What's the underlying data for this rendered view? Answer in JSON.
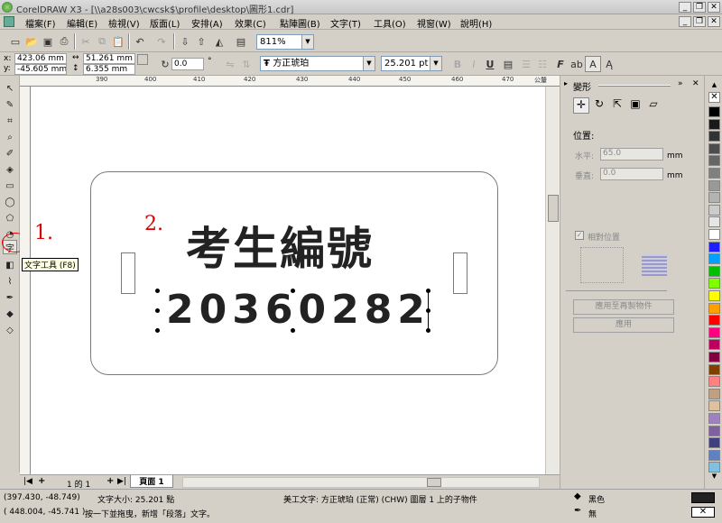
{
  "window": {
    "title": "CorelDRAW X3 - [\\\\a28s003\\cwcsk$\\profile\\desktop\\圖形1.cdr]"
  },
  "menu": [
    "檔案(F)",
    "編輯(E)",
    "檢視(V)",
    "版面(L)",
    "安排(A)",
    "效果(C)",
    "點陣圖(B)",
    "文字(T)",
    "工具(O)",
    "視窗(W)",
    "說明(H)"
  ],
  "standard_toolbar": {
    "zoom": "811%"
  },
  "property_bar": {
    "x": "423.06 mm",
    "y": "-45.605 mm",
    "width": "51.261 mm",
    "height": "6.355 mm",
    "rotation": "0.0",
    "degree_sign": "°",
    "font_name": "方正琥珀",
    "font_size": "25.201 pt"
  },
  "ruler": {
    "h_ticks": [
      "390",
      "400",
      "410",
      "420",
      "430",
      "440",
      "450",
      "460",
      "470"
    ],
    "unit": "公釐"
  },
  "tooltip": "文字工具 (F8)",
  "annotations": {
    "step1": "1.",
    "step2": "2."
  },
  "canvas": {
    "heading": "考生編號",
    "number": "20360282"
  },
  "page_tabs": {
    "page_count": "1 的 1",
    "tab": "頁面 1"
  },
  "docker": {
    "title": "變形",
    "section": "位置:",
    "h_label": "水平:",
    "h_value": "65.0",
    "v_label": "垂直:",
    "v_value": "0.0",
    "unit": "mm",
    "relative": "相對位置",
    "apply_copy": "應用至再製物件",
    "apply": "應用"
  },
  "status": {
    "coords1": "(397.430, -48.749)",
    "font_size": "文字大小: 25.201 點",
    "object_info": "美工文字: 方正琥珀 (正常) (CHW) 圖層 1 上的子物件",
    "coords2": "( 448.004, -45.741 )",
    "hint": "按一下並拖曳，新增「段落」文字。",
    "fill": "黑色",
    "outline": "無"
  },
  "palette": [
    "#000000",
    "#1a1a1a",
    "#333333",
    "#4d4d4d",
    "#666666",
    "#808080",
    "#999999",
    "#b3b3b3",
    "#cccccc",
    "#e6e6e6",
    "#ffffff",
    "#2020ff",
    "#00a0ff",
    "#00c000",
    "#80ff00",
    "#ffff00",
    "#ffa000",
    "#ff0000",
    "#ff0080",
    "#c00060",
    "#800040",
    "#804000",
    "#ff8080",
    "#c0a080",
    "#e0c0a0",
    "#a080c0",
    "#8060a0",
    "#404080",
    "#6080c0",
    "#80c0e0"
  ]
}
